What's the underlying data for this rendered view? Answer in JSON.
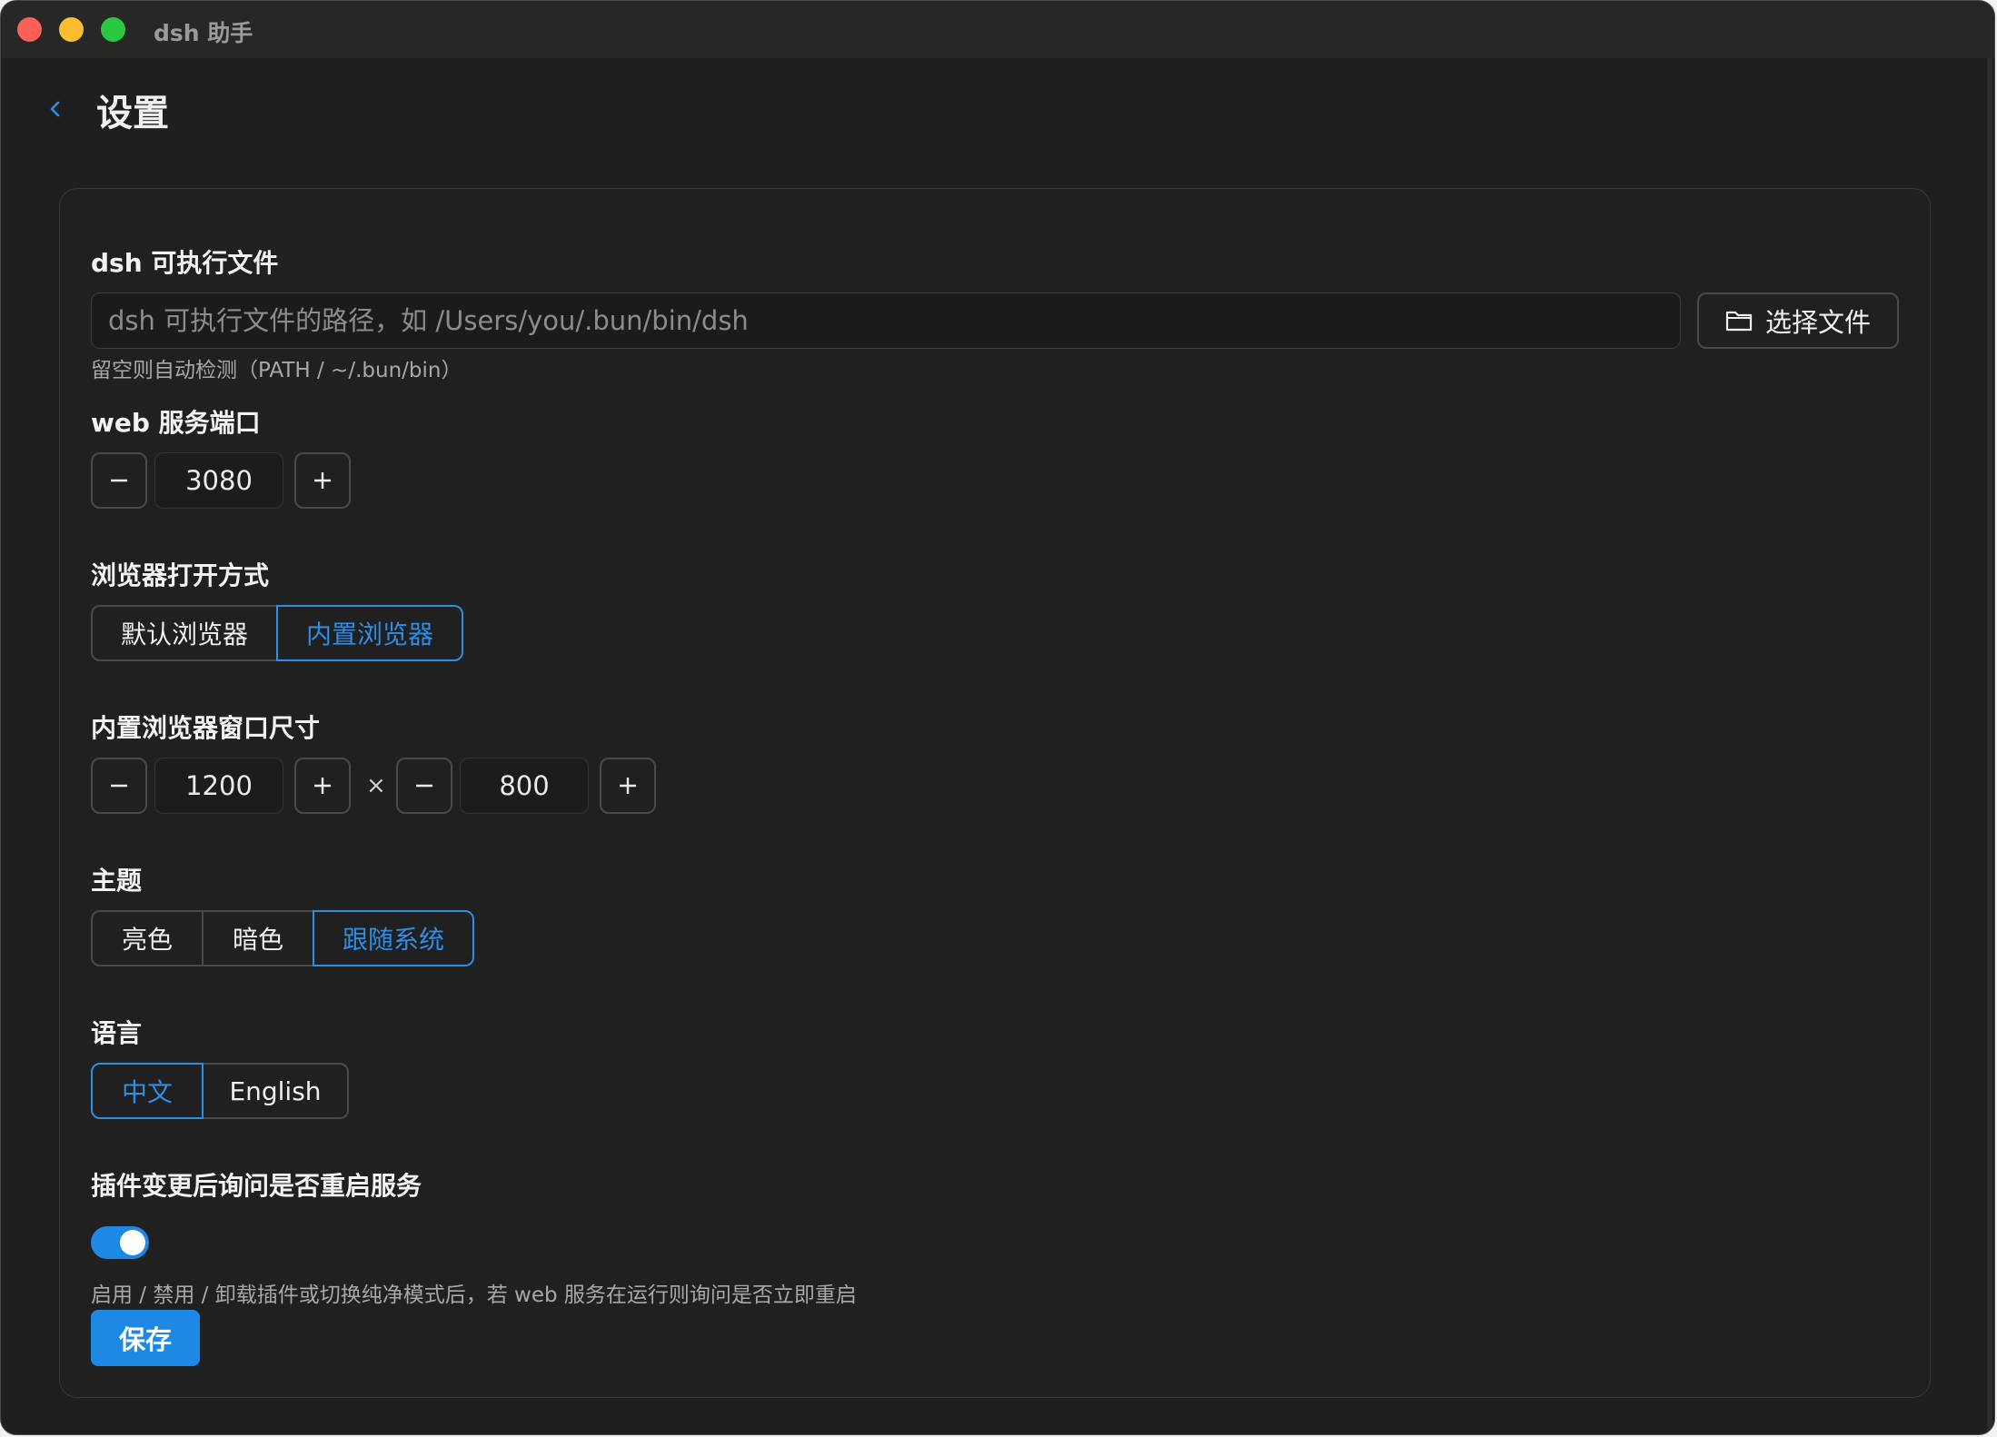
{
  "window": {
    "title": "dsh 助手"
  },
  "header": {
    "title": "设置"
  },
  "executable": {
    "label": "dsh 可执行文件",
    "placeholder": "dsh 可执行文件的路径，如 /Users/you/.bun/bin/dsh",
    "value": "",
    "choose_button": "选择文件",
    "hint": "留空则自动检测（PATH / ~/.bun/bin）"
  },
  "port": {
    "label": "web 服务端口",
    "value": "3080"
  },
  "browser_mode": {
    "label": "浏览器打开方式",
    "options": [
      "默认浏览器",
      "内置浏览器"
    ],
    "selected": "内置浏览器"
  },
  "window_size": {
    "label": "内置浏览器窗口尺寸",
    "width": "1200",
    "height": "800",
    "separator": "×"
  },
  "theme": {
    "label": "主题",
    "options": [
      "亮色",
      "暗色",
      "跟随系统"
    ],
    "selected": "跟随系统"
  },
  "language": {
    "label": "语言",
    "options": [
      "中文",
      "English"
    ],
    "selected": "中文"
  },
  "restart_prompt": {
    "label": "插件变更后询问是否重启服务",
    "enabled": true,
    "hint": "启用 / 禁用 / 卸载插件或切换纯净模式后，若 web 服务在运行则询问是否立即重启"
  },
  "save_button": "保存",
  "colors": {
    "accent": "#2f8de4",
    "primary_button": "#1e88e5",
    "background": "#1f1f1f",
    "titlebar": "#262826"
  },
  "icons": {
    "back": "chevron-left-icon",
    "folder": "folder-icon",
    "minus": "minus-icon",
    "plus": "plus-icon"
  }
}
